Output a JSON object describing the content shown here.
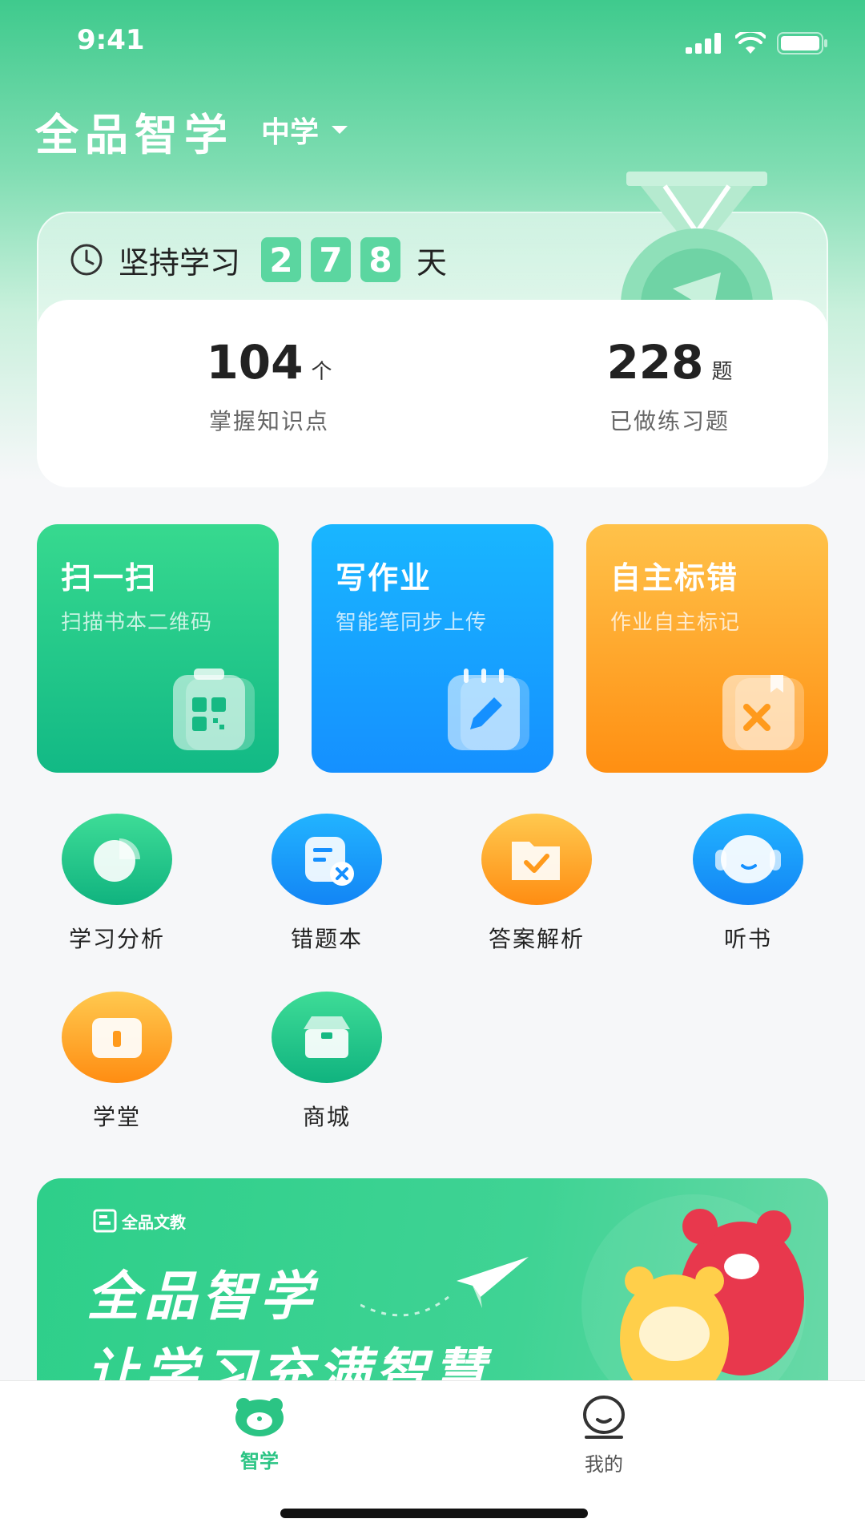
{
  "status_bar": {
    "time": "9:41"
  },
  "header": {
    "app_title": "全品智学",
    "level": "中学"
  },
  "streak": {
    "label": "坚持学习",
    "digits": [
      "2",
      "7",
      "8"
    ],
    "unit": "天"
  },
  "stats": [
    {
      "value": "104",
      "unit": "个",
      "label": "掌握知识点"
    },
    {
      "value": "228",
      "unit": "题",
      "label": "已做练习题"
    }
  ],
  "features": [
    {
      "title": "扫一扫",
      "subtitle": "扫描书本二维码",
      "icon": "qr-scan-icon"
    },
    {
      "title": "写作业",
      "subtitle": "智能笔同步上传",
      "icon": "notebook-pen-icon"
    },
    {
      "title": "自主标错",
      "subtitle": "作业自主标记",
      "icon": "error-mark-icon"
    }
  ],
  "tools": [
    {
      "label": "学习分析",
      "icon": "pie-chart-icon"
    },
    {
      "label": "错题本",
      "icon": "wrong-question-icon"
    },
    {
      "label": "答案解析",
      "icon": "answer-folder-icon"
    },
    {
      "label": "听书",
      "icon": "headphones-icon"
    },
    {
      "label": "学堂",
      "icon": "book-icon"
    },
    {
      "label": "商城",
      "icon": "store-icon"
    }
  ],
  "banner": {
    "brand": "全品文教",
    "line1": "全品智学",
    "line2": "让学习充满智慧"
  },
  "tabs": [
    {
      "label": "智学",
      "icon": "bear-icon",
      "active": true
    },
    {
      "label": "我的",
      "icon": "profile-icon",
      "active": false
    }
  ],
  "colors": {
    "brand_green": "#2bc484",
    "scan_card": "#12b985",
    "write_card": "#1590ff",
    "mark_card": "#ff8f12"
  }
}
